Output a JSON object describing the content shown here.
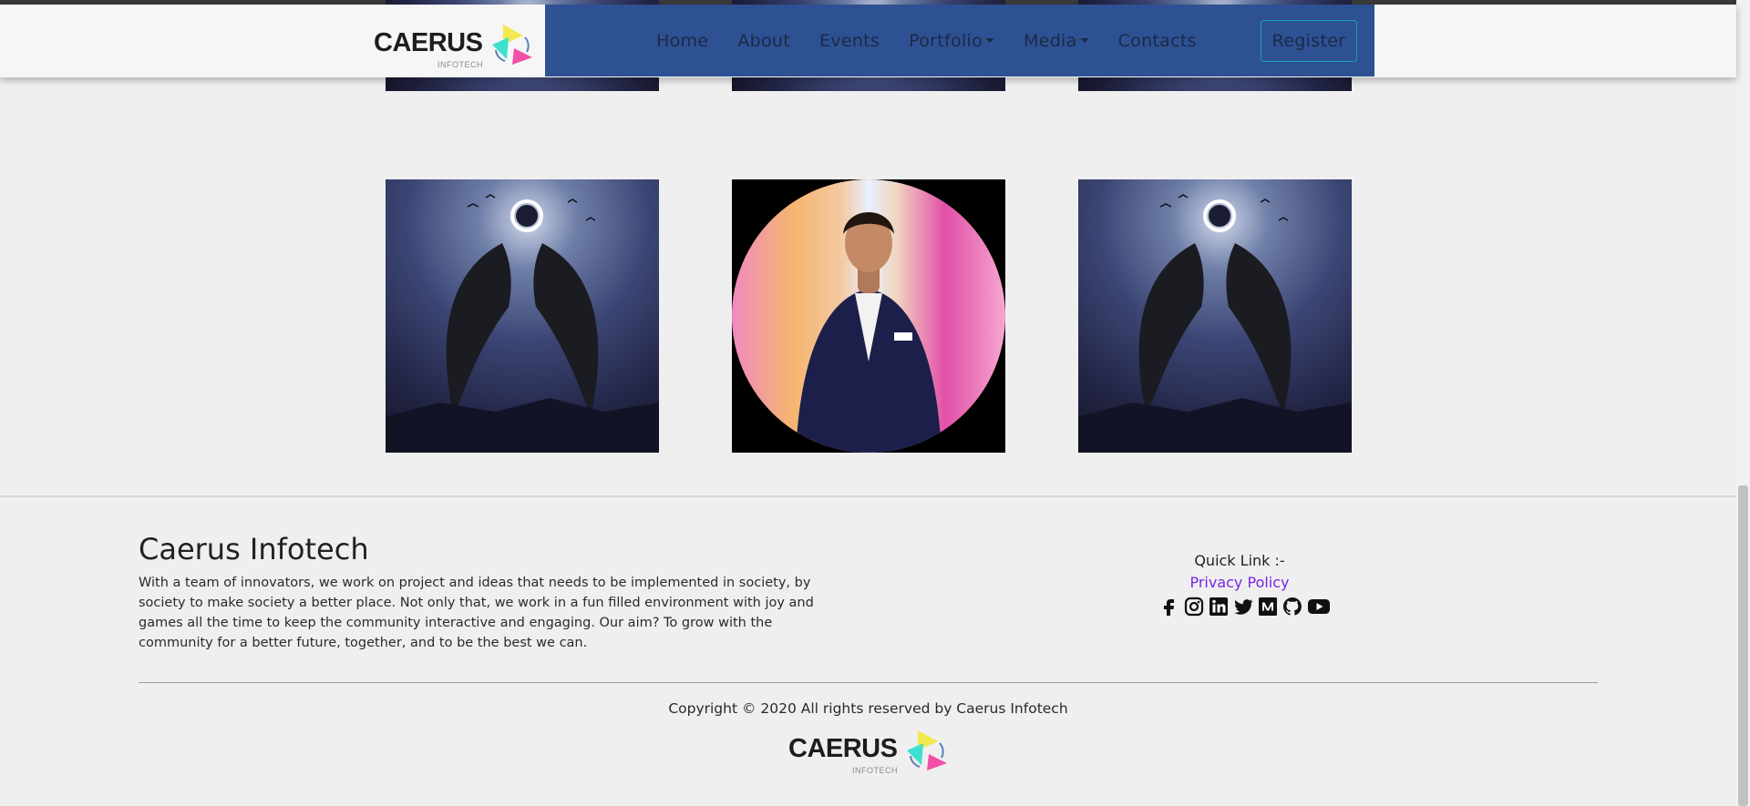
{
  "brand": {
    "name": "CAERUS",
    "sub": "INFOTECH"
  },
  "nav": {
    "items": [
      {
        "label": "Home"
      },
      {
        "label": "About"
      },
      {
        "label": "Events"
      },
      {
        "label": "Portfolio"
      },
      {
        "label": "Media"
      },
      {
        "label": "Contacts"
      }
    ],
    "register_label": "Register"
  },
  "footer": {
    "title": "Caerus Infotech",
    "description": "With a team of innovators, we work on project and ideas that needs to be implemented in society, by society to make society a better place. Not only that, we work in a fun filled environment with joy and games all the time to keep the community interactive and engaging. Our aim? To grow with the community for a better future, together, and to be the best we can.",
    "quick_link_title": "Quick Link :-",
    "privacy_label": "Privacy Policy",
    "social_icons": [
      "facebook-icon",
      "instagram-icon",
      "linkedin-icon",
      "twitter-icon",
      "medium-icon",
      "github-icon",
      "youtube-icon"
    ],
    "copyright": "Copyright © 2020 All rights reserved by Caerus Infotech"
  },
  "colors": {
    "nav_panel": "#2e5193",
    "register_border": "#17a2b8",
    "link": "#7a25e6",
    "logo_yellow": "#f2e94e",
    "logo_cyan": "#3ee0d0",
    "logo_pink": "#f24fa8"
  }
}
